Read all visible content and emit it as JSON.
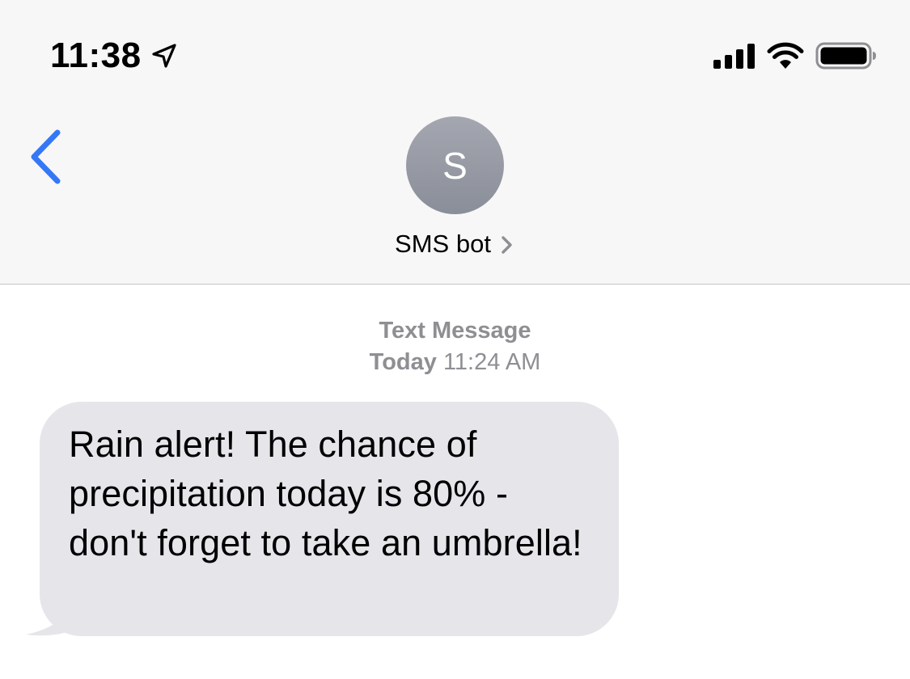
{
  "status_bar": {
    "time": "11:38",
    "icons": [
      "location-arrow-icon",
      "signal-bars-icon",
      "wifi-icon",
      "battery-icon"
    ]
  },
  "nav": {
    "back_icon": "chevron-left-icon",
    "avatar_initial": "S",
    "contact_name": "SMS bot",
    "contact_chevron_icon": "chevron-right-icon"
  },
  "conversation": {
    "message_type": "Text Message",
    "date_label": "Today",
    "time_label": "11:24 AM",
    "messages": [
      {
        "direction": "incoming",
        "text": "Rain alert! The chance of precipitation today is 80% - don't forget to take an umbrella!"
      }
    ]
  },
  "colors": {
    "accent": "#3478f6",
    "bubble_incoming": "#e5e5ea",
    "header_bg": "#f7f7f7",
    "meta_text": "#8e8e93"
  }
}
